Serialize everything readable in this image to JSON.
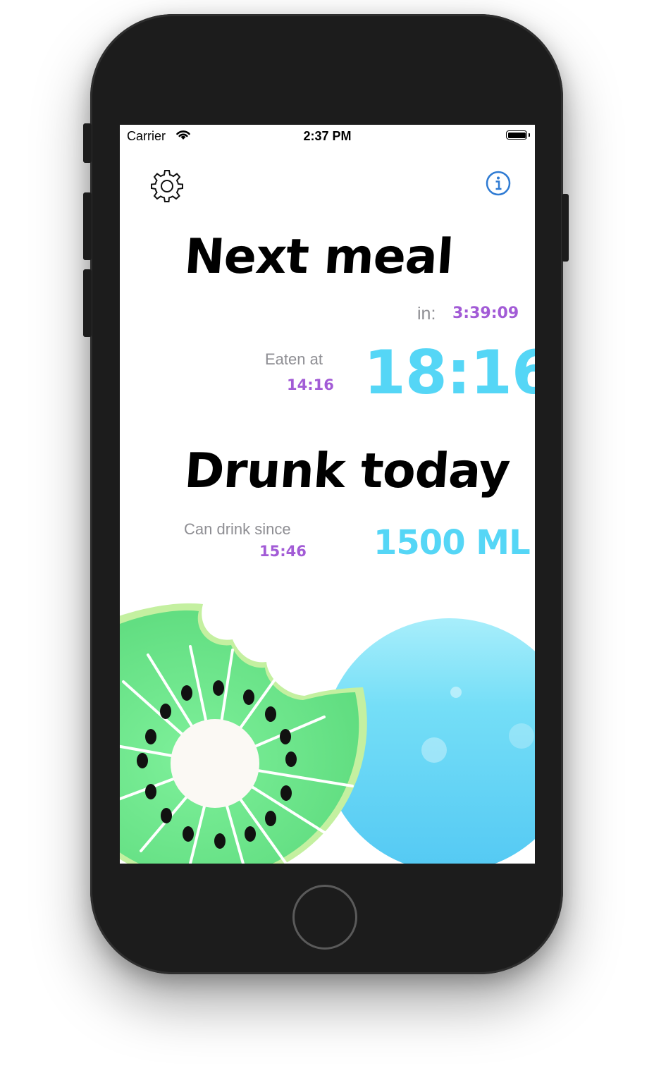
{
  "status_bar": {
    "carrier": "Carrier",
    "time": "2:37 PM"
  },
  "toolbar": {
    "settings_icon": "gear-icon",
    "info_icon": "info-icon"
  },
  "next_meal": {
    "title": "Next meal",
    "in_label": "in:",
    "countdown": "3:39:09",
    "eaten_label": "Eaten at",
    "eaten_time": "14:16",
    "next_time": "18:16"
  },
  "drunk_today": {
    "title": "Drunk today",
    "can_drink_label": "Can drink since",
    "can_drink_time": "15:46",
    "amount": "1500 ML"
  },
  "colors": {
    "accent_purple": "#a25bd6",
    "accent_cyan": "#55d6f6",
    "kiwi_green": "#6ee68c",
    "water_blue": "#5fd3f7",
    "info_blue": "#2f7bd3"
  }
}
